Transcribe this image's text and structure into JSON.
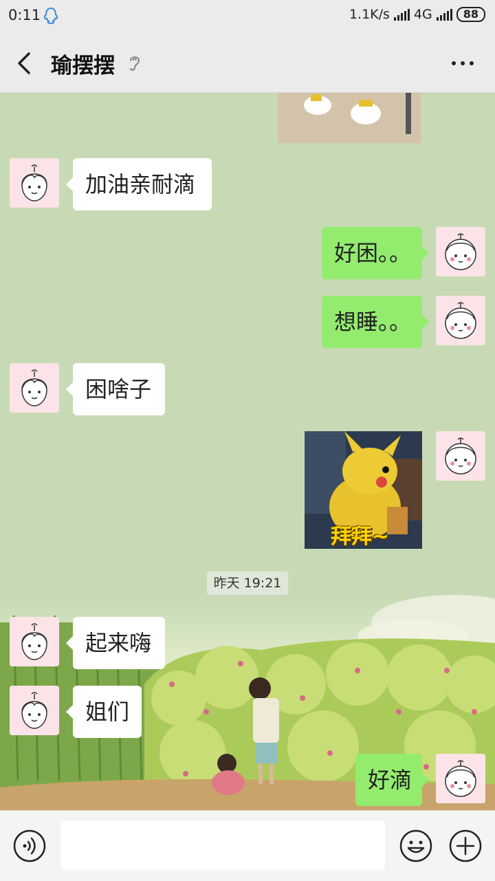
{
  "status_bar": {
    "time": "0:11",
    "net_speed": "1.1K/s",
    "network": "4G",
    "battery": "88"
  },
  "header": {
    "back_label": "Back",
    "title": "瑜摆摆",
    "more_label": "More"
  },
  "messages": [
    {
      "side": "left",
      "text": "加油亲耐滴"
    },
    {
      "side": "right",
      "text": "好困。。"
    },
    {
      "side": "right",
      "text": "想睡。。"
    },
    {
      "side": "left",
      "text": "困啥子"
    },
    {
      "side": "right",
      "type": "image",
      "caption": "拜拜~"
    },
    {
      "type": "timestamp",
      "text": "昨天 19:21"
    },
    {
      "side": "left",
      "text": "起来嗨"
    },
    {
      "side": "left",
      "text": "姐们"
    },
    {
      "side": "right",
      "text": "好滴"
    }
  ],
  "input": {
    "placeholder": "",
    "value": ""
  },
  "icons": [
    "qq-icon",
    "signal-icon",
    "battery-icon",
    "back-icon",
    "ear-icon",
    "more-icon",
    "voice-icon",
    "emoji-icon",
    "plus-icon"
  ]
}
